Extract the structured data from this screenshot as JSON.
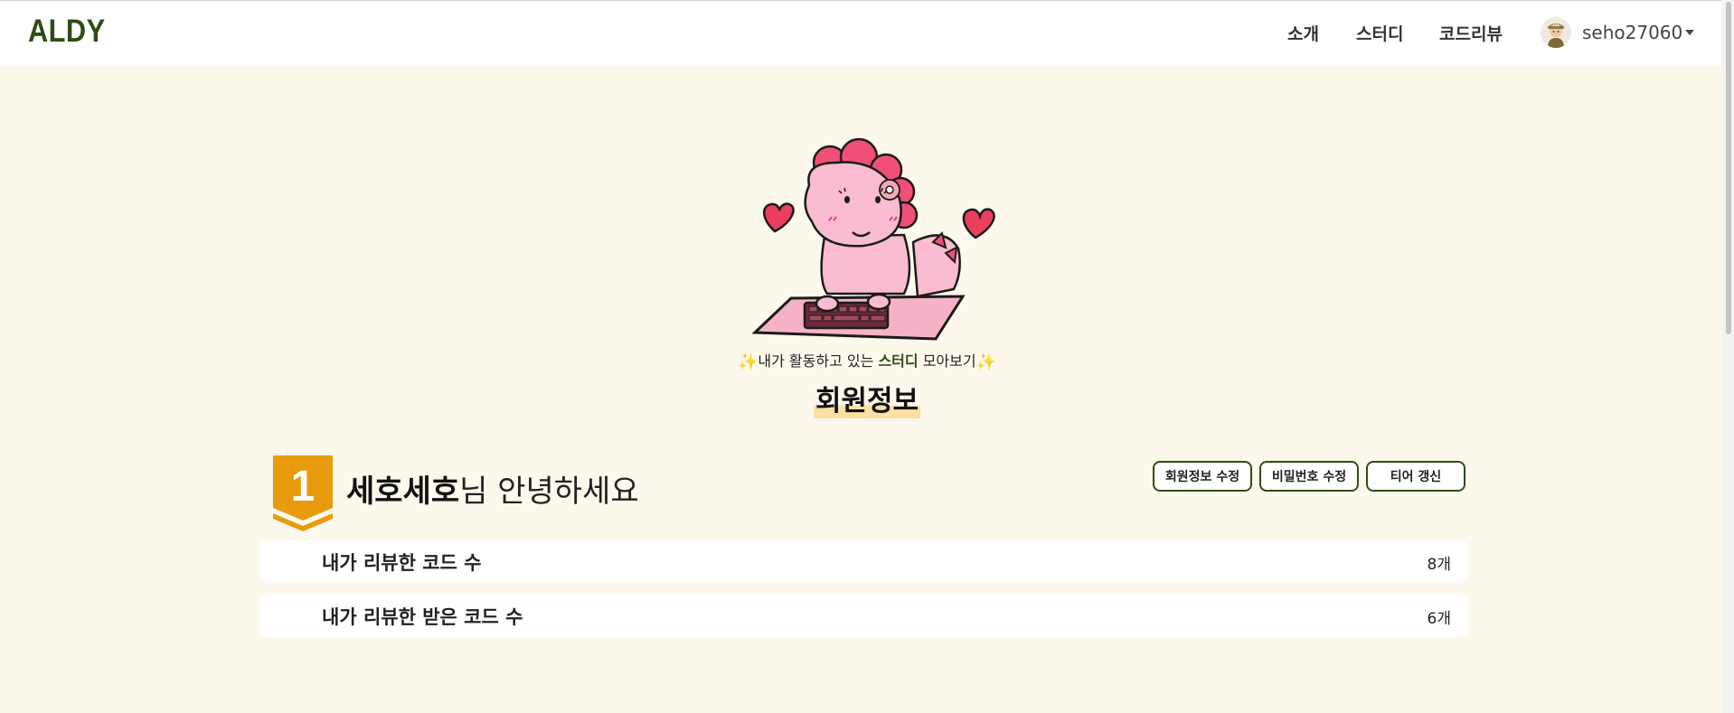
{
  "navbar": {
    "logo": "ALDY",
    "links": [
      "소개",
      "스터디",
      "코드리뷰"
    ],
    "username": "seho27060"
  },
  "hero": {
    "tagline_prefix": "내가 활동하고 있는 ",
    "tagline_highlight": "스터디",
    "tagline_suffix": " 모아보기",
    "sparkle_icon": "✨"
  },
  "page": {
    "title": "회원정보"
  },
  "profile": {
    "tier_number": "1",
    "nickname": "세호세호",
    "greeting_suffix": "님 안녕하세요",
    "buttons": [
      "회원정보 수정",
      "비밀번호 수정",
      "티어 갱신"
    ]
  },
  "stats": [
    {
      "label": "내가 리뷰한 코드 수",
      "value": "8개"
    },
    {
      "label": "내가 리뷰한 받은 코드 수",
      "value": "6개"
    }
  ],
  "colors": {
    "background": "#fdf8ec",
    "brand": "#2f4d15",
    "badge": "#e89b0c",
    "title_highlight": "#fce0a3"
  }
}
